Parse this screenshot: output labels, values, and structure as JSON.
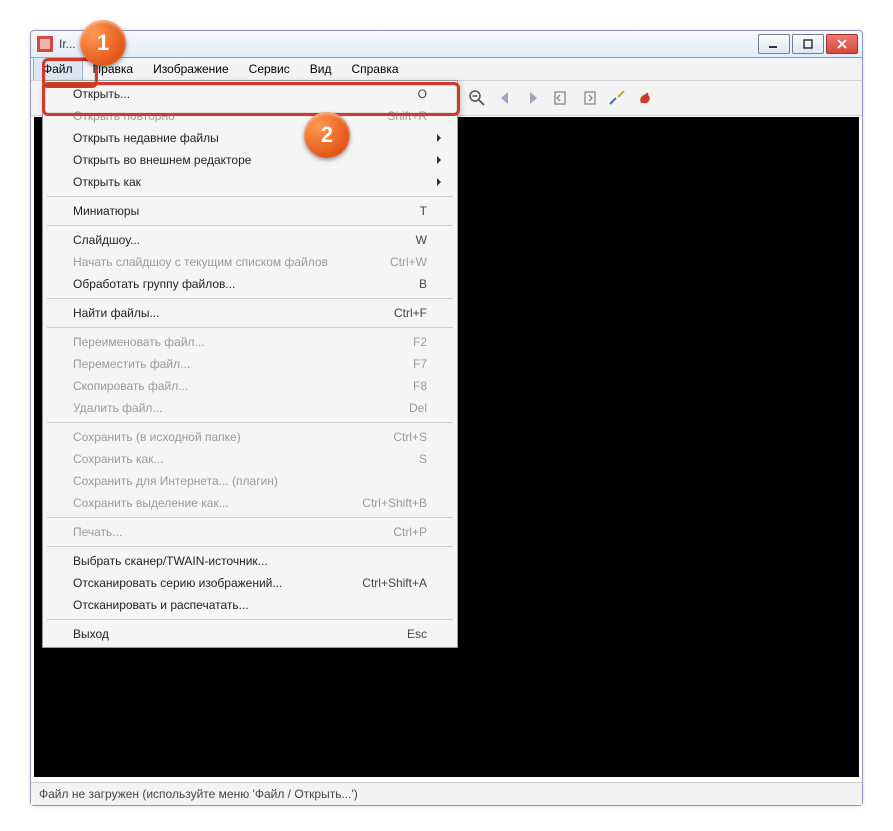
{
  "titlebar": {
    "app_title": "Ir..."
  },
  "menubar": {
    "items": [
      "Файл",
      "Правка",
      "Изображение",
      "Сервис",
      "Вид",
      "Справка"
    ]
  },
  "toolbar": {
    "icons": [
      "open",
      "save",
      "cut",
      "copy",
      "paste",
      "undo",
      "info",
      "zoom-in",
      "zoom-out",
      "arrow-left",
      "arrow-right",
      "move-prev",
      "move-next",
      "settings",
      "about"
    ]
  },
  "statusbar": {
    "text": "Файл не загружен (используйте меню 'Файл / Открыть...')"
  },
  "dropdown": {
    "groups": [
      [
        {
          "label": "Открыть...",
          "shortcut": "O",
          "enabled": true,
          "submenu": false
        },
        {
          "label": "Открыть повторно",
          "shortcut": "Shift+R",
          "enabled": false,
          "submenu": false
        },
        {
          "label": "Открыть недавние файлы",
          "shortcut": "",
          "enabled": true,
          "submenu": true
        },
        {
          "label": "Открыть во внешнем редакторе",
          "shortcut": "",
          "enabled": true,
          "submenu": true
        },
        {
          "label": "Открыть как",
          "shortcut": "",
          "enabled": true,
          "submenu": true
        }
      ],
      [
        {
          "label": "Миниатюры",
          "shortcut": "T",
          "enabled": true,
          "submenu": false
        }
      ],
      [
        {
          "label": "Слайдшоу...",
          "shortcut": "W",
          "enabled": true,
          "submenu": false
        },
        {
          "label": "Начать слайдшоу с текущим списком файлов",
          "shortcut": "Ctrl+W",
          "enabled": false,
          "submenu": false
        },
        {
          "label": "Обработать группу файлов...",
          "shortcut": "B",
          "enabled": true,
          "submenu": false
        }
      ],
      [
        {
          "label": "Найти файлы...",
          "shortcut": "Ctrl+F",
          "enabled": true,
          "submenu": false
        }
      ],
      [
        {
          "label": "Переименовать файл...",
          "shortcut": "F2",
          "enabled": false,
          "submenu": false
        },
        {
          "label": "Переместить файл...",
          "shortcut": "F7",
          "enabled": false,
          "submenu": false
        },
        {
          "label": "Скопировать файл...",
          "shortcut": "F8",
          "enabled": false,
          "submenu": false
        },
        {
          "label": "Удалить файл...",
          "shortcut": "Del",
          "enabled": false,
          "submenu": false
        }
      ],
      [
        {
          "label": "Сохранить (в исходной папке)",
          "shortcut": "Ctrl+S",
          "enabled": false,
          "submenu": false
        },
        {
          "label": "Сохранить как...",
          "shortcut": "S",
          "enabled": false,
          "submenu": false
        },
        {
          "label": "Сохранить для Интернета... (плагин)",
          "shortcut": "",
          "enabled": false,
          "submenu": false
        },
        {
          "label": "Сохранить выделение как...",
          "shortcut": "Ctrl+Shift+B",
          "enabled": false,
          "submenu": false
        }
      ],
      [
        {
          "label": "Печать...",
          "shortcut": "Ctrl+P",
          "enabled": false,
          "submenu": false
        }
      ],
      [
        {
          "label": "Выбрать сканер/TWAIN-источник...",
          "shortcut": "",
          "enabled": true,
          "submenu": false
        },
        {
          "label": "Отсканировать серию изображений...",
          "shortcut": "Ctrl+Shift+A",
          "enabled": true,
          "submenu": false
        },
        {
          "label": "Отсканировать и распечатать...",
          "shortcut": "",
          "enabled": true,
          "submenu": false
        }
      ],
      [
        {
          "label": "Выход",
          "shortcut": "Esc",
          "enabled": true,
          "submenu": false
        }
      ]
    ]
  },
  "callouts": {
    "n1": "1",
    "n2": "2"
  }
}
